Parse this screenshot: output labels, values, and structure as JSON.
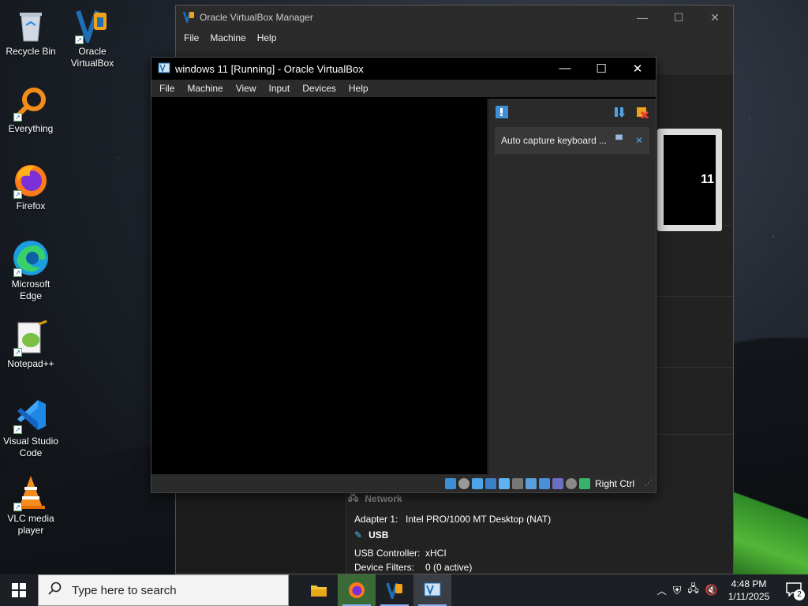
{
  "desktop": {
    "icons": [
      {
        "label": "Recycle Bin"
      },
      {
        "label": "Oracle VirtualBox"
      },
      {
        "label": "Everything"
      },
      {
        "label": "Firefox"
      },
      {
        "label": "Microsoft Edge"
      },
      {
        "label": "Notepad++"
      },
      {
        "label": "Visual Studio Code"
      },
      {
        "label": "VLC media player"
      }
    ]
  },
  "manager": {
    "title": "Oracle VirtualBox Manager",
    "menu": [
      "File",
      "Machine",
      "Help"
    ],
    "preview_text": "11",
    "network_label": "Network",
    "adapter_key": "Adapter 1:",
    "adapter_value": "Intel PRO/1000 MT Desktop (NAT)",
    "usb_title": "USB",
    "usb_controller_key": "USB Controller:",
    "usb_controller_value": "xHCI",
    "device_filters_key": "Device Filters:",
    "device_filters_value": "0 (0 active)"
  },
  "vm": {
    "title": "windows 11 [Running] - Oracle VirtualBox",
    "menu": [
      "File",
      "Machine",
      "View",
      "Input",
      "Devices",
      "Help"
    ],
    "notification_text": "Auto capture keyboard ...",
    "host_key": "Right Ctrl"
  },
  "taskbar": {
    "search_placeholder": "Type here to search",
    "time": "4:48 PM",
    "date": "1/11/2025",
    "notification_count": "2"
  },
  "colors": {
    "accent": "#8ab4f8",
    "vbox_blue": "#1f6fb5"
  }
}
